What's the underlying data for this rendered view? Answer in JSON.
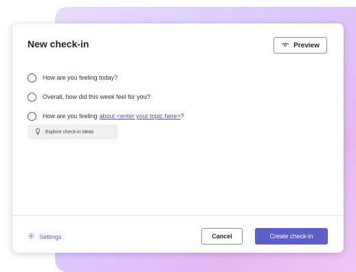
{
  "dialog": {
    "title": "New check-in",
    "preview_label": "Preview",
    "options": [
      {
        "text": "How are you feeling today?"
      },
      {
        "text": "Overall, how did this week feel for you?"
      },
      {
        "text": "How are you feeling",
        "link_text": "about <enter your topic here>",
        "suffix": "?"
      }
    ],
    "explore_label": "Explore check-in ideas",
    "footer": {
      "settings_label": "Settings",
      "cancel_label": "Cancel",
      "create_label": "Create check-in"
    }
  },
  "colors": {
    "accent": "#5b5fc7",
    "link": "#4f52b2",
    "gradient_start": "#e7dcff",
    "gradient_end": "#f0c8f6"
  },
  "icons": [
    "eye-icon",
    "lightbulb-icon",
    "gear-icon"
  ]
}
